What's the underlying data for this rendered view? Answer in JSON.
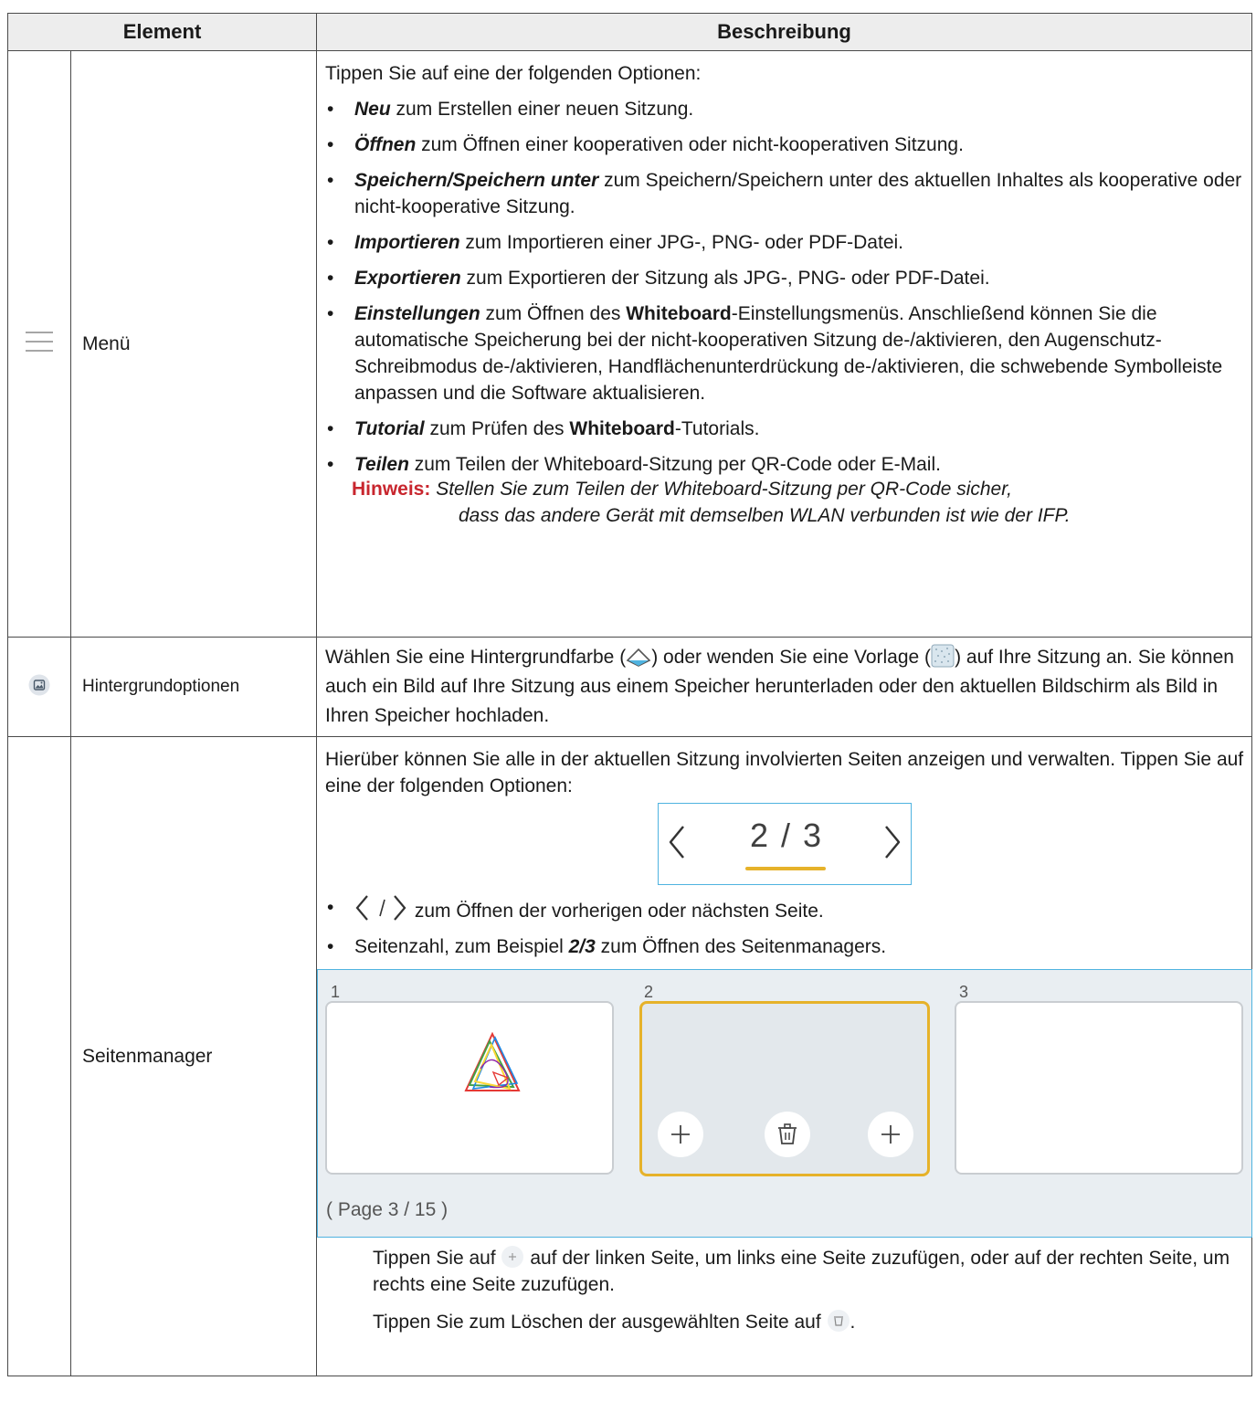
{
  "table": {
    "header": {
      "col1": "Element",
      "col2": "Beschreibung"
    },
    "menu_row": {
      "icon": "hamburger-menu-icon",
      "name": "Menü",
      "intro": "Tippen Sie auf eine der folgenden Optionen:",
      "items": [
        {
          "bold": "Neu",
          "text": " zum Erstellen einer neuen Sitzung."
        },
        {
          "bold": "Öffnen",
          "text": " zum Öffnen einer kooperativen oder nicht-kooperativen Sitzung."
        },
        {
          "bold": "Speichern/Speichern unter",
          "text": " zum Speichern/Speichern unter des aktuellen Inhaltes als kooperative oder nicht-kooperative Sitzung."
        },
        {
          "bold": "Importieren",
          "text": " zum Importieren einer JPG-, PNG- oder PDF-Datei."
        },
        {
          "bold": "Exportieren",
          "text": " zum Exportieren der Sitzung als JPG-, PNG- oder PDF-Datei."
        }
      ],
      "settings": {
        "bold": "Einstellungen",
        "text_a": " zum Öffnen des ",
        "strong": "Whiteboard",
        "text_b": "-Einstellungsmenüs. Anschließend können Sie die automatische Speicherung bei der nicht-kooperativen Sitzung de-/aktivieren, den Augenschutz-Schreibmodus de-/aktivieren, Handflächenunterdrückung de-/aktivieren, die schwebende Symbolleiste anpassen und die Software aktualisieren."
      },
      "tutorial": {
        "bold": "Tutorial",
        "text_a": " zum Prüfen des ",
        "strong": "Whiteboard",
        "text_b": "-Tutorials."
      },
      "share": {
        "bold": "Teilen",
        "text": " zum Teilen der Whiteboard-Sitzung per QR-Code oder E-Mail."
      },
      "note": {
        "label": "Hinweis:",
        "line1": "Stellen Sie zum Teilen der Whiteboard-Sitzung per QR-Code sicher,",
        "line2": "dass das andere Gerät mit demselben WLAN verbunden ist wie der IFP."
      }
    },
    "background_row": {
      "icon": "image-icon",
      "name": "Hintergrundoptionen",
      "text_a": "Wählen Sie eine Hintergrundfarbe (",
      "text_b": ") oder wenden Sie eine Vorlage (",
      "text_c": ") auf Ihre Sitzung an. Sie können auch ein Bild auf Ihre Sitzung aus einem Speicher herunterladen oder den aktuellen Bildschirm als Bild in Ihren Speicher hochladen."
    },
    "pages_row": {
      "name": "Seitenmanager",
      "intro": "Hierüber können Sie alle in der aktuellen Sitzung involvierten Seiten anzeigen und verwalten. Tippen Sie auf eine der folgenden Optionen:",
      "pager_text": "2 / 3",
      "bullet_nav": " zum Öffnen der vorherigen oder nächsten Seite.",
      "bullet_count_a": "Seitenzahl, zum Beispiel ",
      "bullet_count_bold": "2/3",
      "bullet_count_b": " zum Öffnen des Seitenmanagers.",
      "page_numbers": [
        "1",
        "2",
        "3"
      ],
      "page_footer": "( Page 3 / 15 )",
      "add_text_a": "Tippen Sie auf ",
      "add_text_b": " auf der linken Seite, um links eine Seite zuzufügen, oder auf der rechten Seite, um rechts eine Seite zuzufügen.",
      "delete_text_a": "Tippen Sie zum Löschen der ausgewählten Seite auf ",
      "delete_text_b": "."
    }
  },
  "colors": {
    "note_red": "#c8262e",
    "accent_blue": "#4fb3e0",
    "highlight_yellow": "#e6b22a"
  }
}
